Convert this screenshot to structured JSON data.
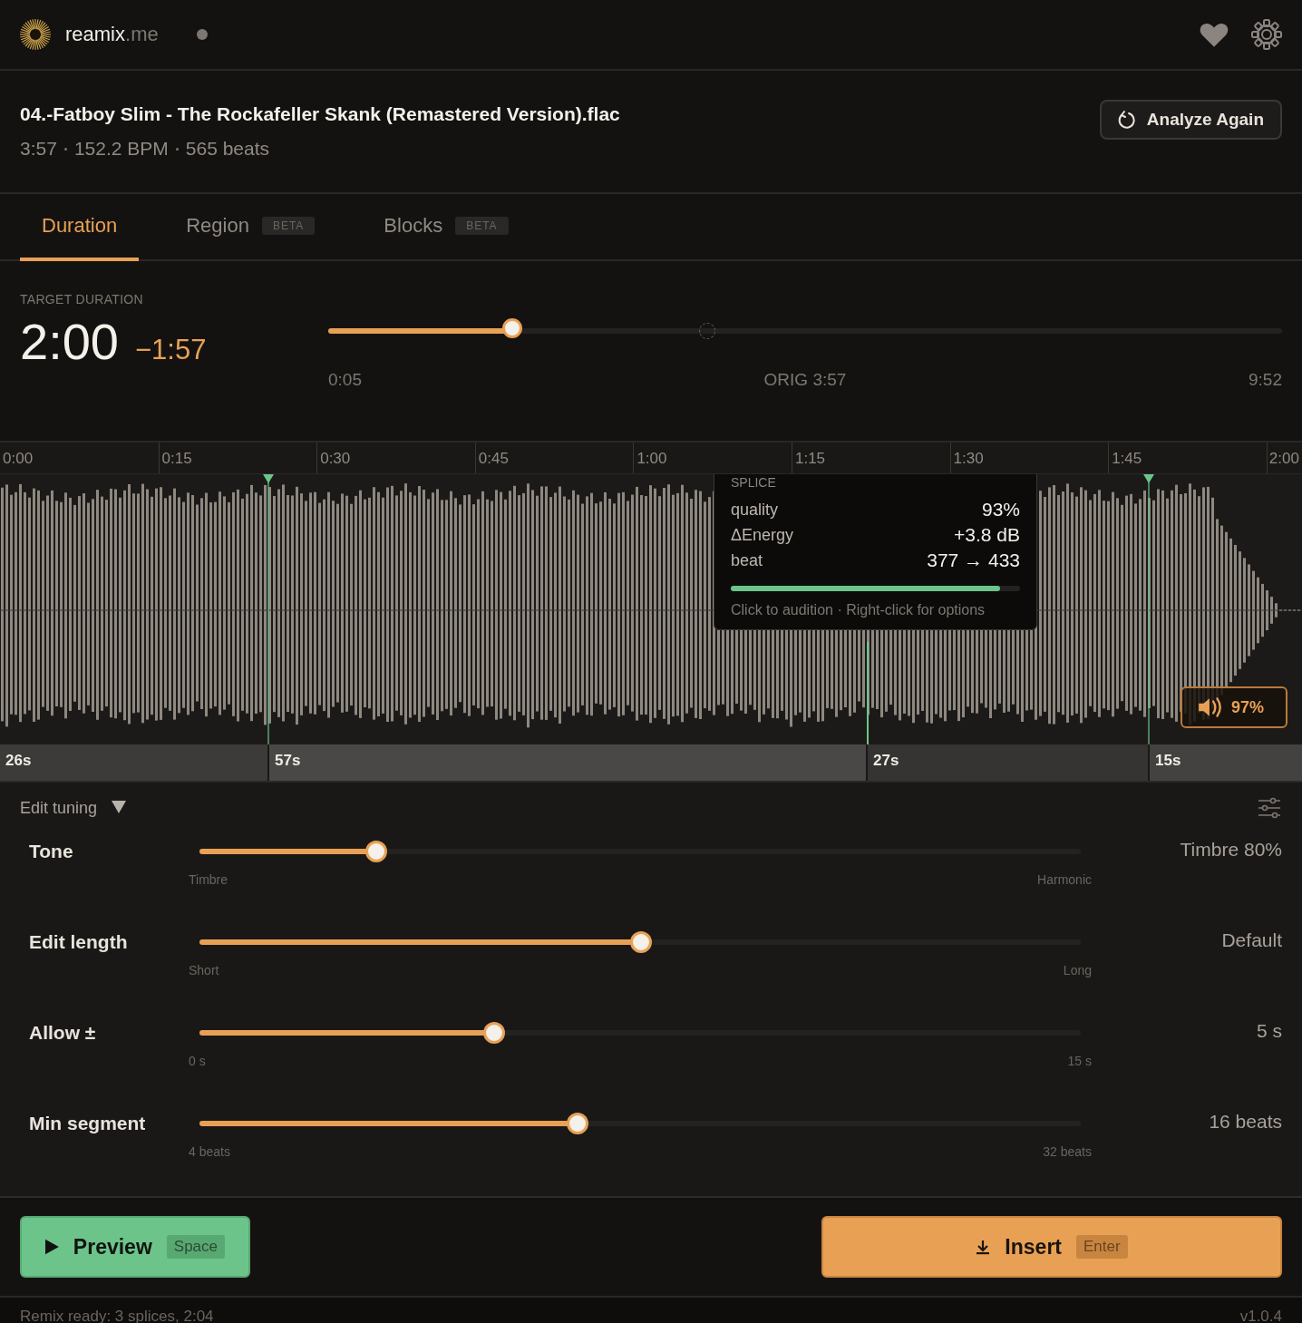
{
  "header": {
    "brand": "reamix",
    "brand_suffix": ".me"
  },
  "track": {
    "title": "04.-Fatboy Slim - The Rockafeller Skank (Remastered Version).flac",
    "duration": "3:57",
    "bpm": "152.2 BPM",
    "beats": "565 beats",
    "analyze_button": "Analyze Again"
  },
  "tabs": [
    {
      "label": "Duration",
      "selected": true
    },
    {
      "label": "Region",
      "badge": "BETA",
      "selected": false
    },
    {
      "label": "Blocks",
      "badge": "BETA",
      "selected": false
    }
  ],
  "target": {
    "label": "TARGET DURATION",
    "value": "2:00",
    "delta": "−1:57",
    "level": 0.196,
    "min": "0:05",
    "orig": "ORIG 3:57",
    "max": "9:52"
  },
  "timeline": {
    "ticks": [
      "0:00",
      "0:15",
      "0:30",
      "0:45",
      "1:00",
      "1:15",
      "1:30",
      "1:45",
      "2:00"
    ],
    "segments": [
      "26s",
      "57s",
      "27s",
      "15s"
    ],
    "tooltip": {
      "title": "SPLICE",
      "rows": [
        {
          "label": "quality",
          "value": "93%"
        },
        {
          "label": "ΔEnergy",
          "value": "+3.8 dB"
        },
        {
          "label": "beat",
          "value": "377 → 433"
        }
      ],
      "level": 0.93,
      "hint": "Click to audition · Right-click for options"
    },
    "volume": "97%"
  },
  "tuning": {
    "title": "Edit tuning",
    "expanded": true,
    "sliders": [
      {
        "name": "Tone",
        "level": 0.2,
        "min": "Timbre",
        "max": "Harmonic",
        "reading": "Timbre 80%"
      },
      {
        "name": "Edit length",
        "level": 0.5,
        "min": "Short",
        "max": "Long",
        "reading": "Default"
      },
      {
        "name": "Allow ±",
        "level": 0.333,
        "min": "0 s",
        "max": "15 s",
        "reading": "5 s"
      },
      {
        "name": "Min segment",
        "level": 0.428,
        "min": "4 beats",
        "max": "32 beats",
        "reading": "16 beats"
      }
    ]
  },
  "actions": {
    "preview": {
      "label": "Preview",
      "key": "Space"
    },
    "insert": {
      "label": "Insert",
      "key": "Enter"
    }
  },
  "status_bar": {
    "message": "Remix ready: 3 splices, 2:04",
    "version": "v1.0.4"
  }
}
